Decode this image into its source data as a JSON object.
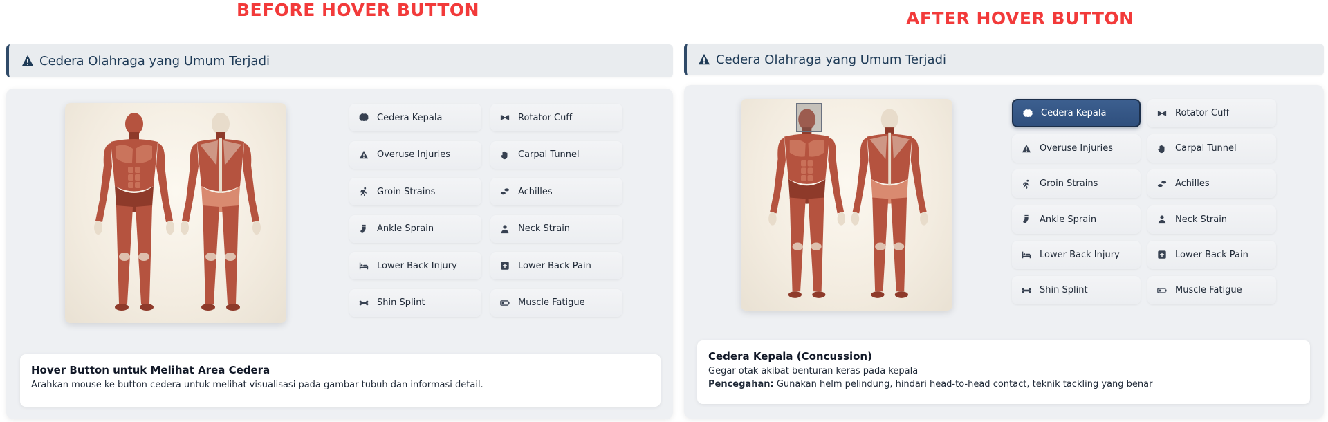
{
  "labels": {
    "before": "BEFORE HOVER BUTTON",
    "after": "AFTER HOVER BUTTON"
  },
  "section": {
    "title": "Cedera Olahraga yang Umum Terjadi",
    "icon": "warning-triangle-icon"
  },
  "injuries": [
    {
      "label": "Cedera Kepala",
      "icon": "brain-icon"
    },
    {
      "label": "Rotator Cuff",
      "icon": "dumbbell-icon"
    },
    {
      "label": "Overuse Injuries",
      "icon": "warning-icon"
    },
    {
      "label": "Carpal Tunnel",
      "icon": "hand-icon"
    },
    {
      "label": "Groin Strains",
      "icon": "running-icon"
    },
    {
      "label": "Achilles",
      "icon": "shoe-prints-icon"
    },
    {
      "label": "Ankle Sprain",
      "icon": "sock-icon"
    },
    {
      "label": "Neck Strain",
      "icon": "user-icon"
    },
    {
      "label": "Lower Back Injury",
      "icon": "bed-icon"
    },
    {
      "label": "Lower Back Pain",
      "icon": "plus-square-icon"
    },
    {
      "label": "Shin Splint",
      "icon": "bone-icon"
    },
    {
      "label": "Muscle Fatigue",
      "icon": "battery-low-icon"
    }
  ],
  "before_state": {
    "card_title": "Hover Button untuk Melihat Area Cedera",
    "card_text": "Arahkan mouse ke button cedera untuk melihat visualisasi pada gambar tubuh dan informasi detail."
  },
  "after_state": {
    "active": "Cedera Kepala",
    "card_title": "Cedera Kepala (Concussion)",
    "card_text": "Gegar otak akibat benturan keras pada kepala",
    "prevention_label": "Pencegahan:",
    "prevention_text": " Gunakan helm pelindung, hindari head-to-head contact, teknik tackling yang benar"
  },
  "colors": {
    "accent": "#2f4f7d",
    "label_red": "#f23a3a",
    "header_text": "#1f3b57"
  }
}
